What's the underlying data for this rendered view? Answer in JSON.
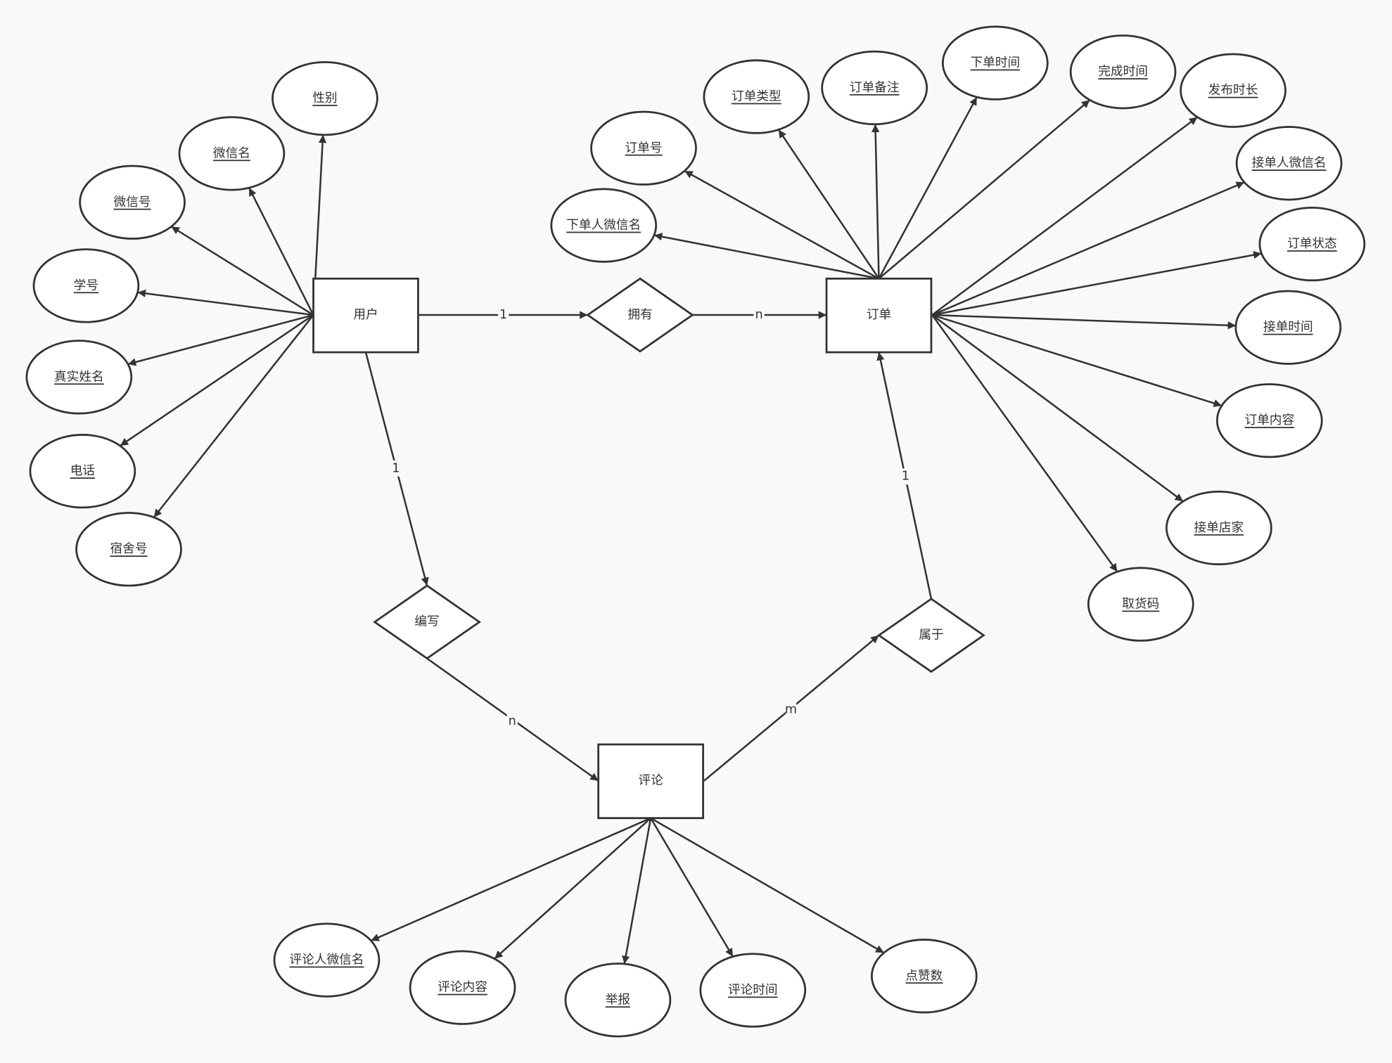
{
  "entities": {
    "user": "用户",
    "order": "订单",
    "comment": "评论"
  },
  "relationships": {
    "own": "拥有",
    "write": "编写",
    "belong": "属于"
  },
  "attributes": {
    "user": [
      "性别",
      "微信名",
      "微信号",
      "学号",
      "真实姓名",
      "电话",
      "宿舍号"
    ],
    "order": [
      "订单号",
      "订单类型",
      "订单备注",
      "下单时间",
      "完成时间",
      "发布时长",
      "接单人微信名",
      "订单状态",
      "接单时间",
      "订单内容",
      "接单店家",
      "取货码",
      "下单人微信名"
    ],
    "comment": [
      "评论人微信名",
      "评论内容",
      "举报",
      "评论时间",
      "点赞数"
    ]
  },
  "cardinalities": {
    "user_own": "1",
    "own_order": "n",
    "user_write": "1",
    "write_comment": "n",
    "comment_belong": "m",
    "belong_order": "1"
  },
  "colors": {
    "stroke": "#333333",
    "fill": "#ffffff",
    "background": "#f9f9f9"
  }
}
